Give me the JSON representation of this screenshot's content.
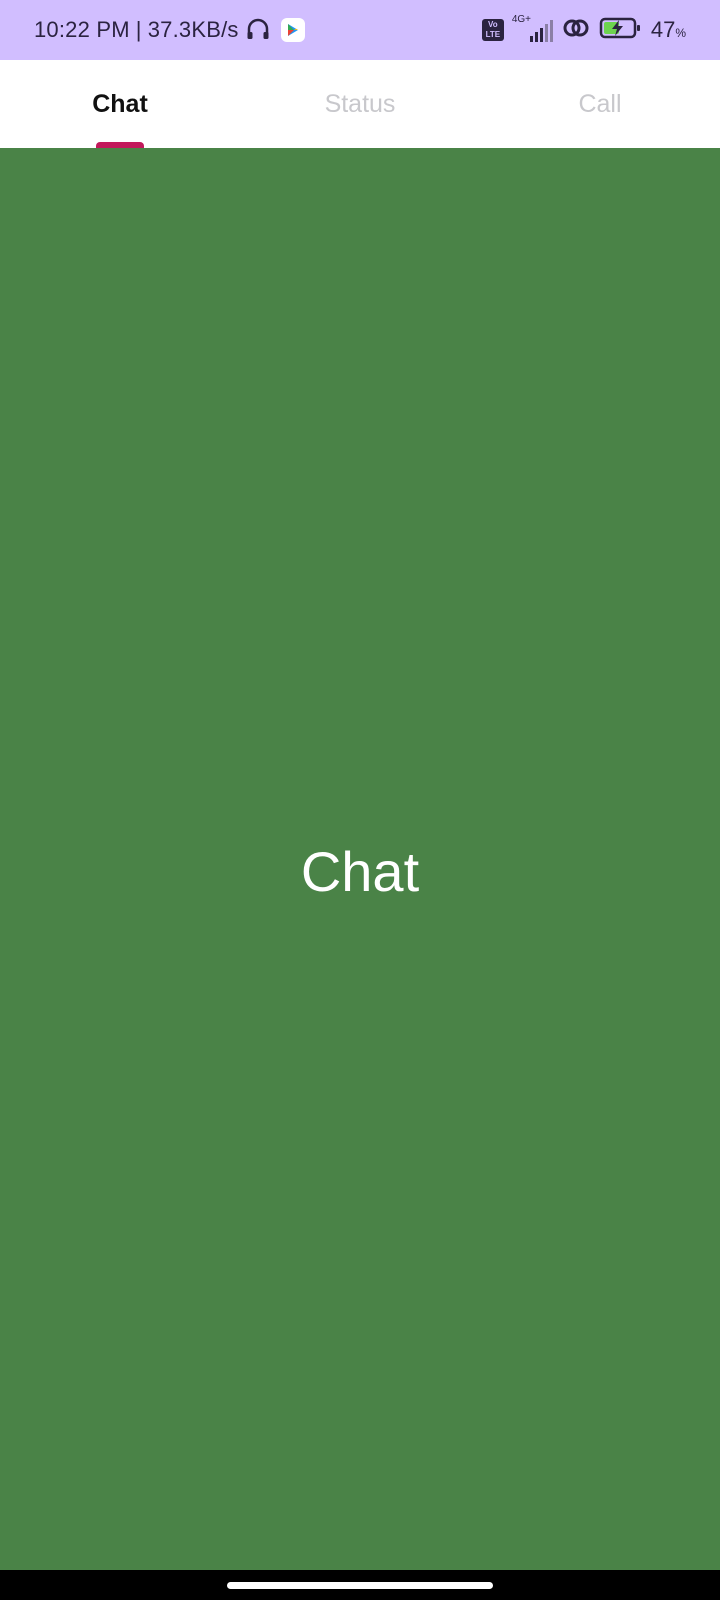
{
  "status_bar": {
    "time": "10:22 PM",
    "separator": "|",
    "speed": "37.3KB/s",
    "volte_top": "Vo",
    "volte_bottom": "LTE",
    "network": "4G+",
    "battery_value": "47",
    "battery_unit": "%",
    "background": "#d1beff",
    "icons": [
      "headphone-icon",
      "play-store-icon",
      "volte-icon",
      "signal-icon",
      "link-icon",
      "battery-charging-icon"
    ]
  },
  "tabs": [
    {
      "label": "Chat",
      "active": true
    },
    {
      "label": "Status",
      "active": false
    },
    {
      "label": "Call",
      "active": false
    }
  ],
  "content": {
    "title": "Chat",
    "background": "#4a8347"
  },
  "accent_color": "#c2185b"
}
